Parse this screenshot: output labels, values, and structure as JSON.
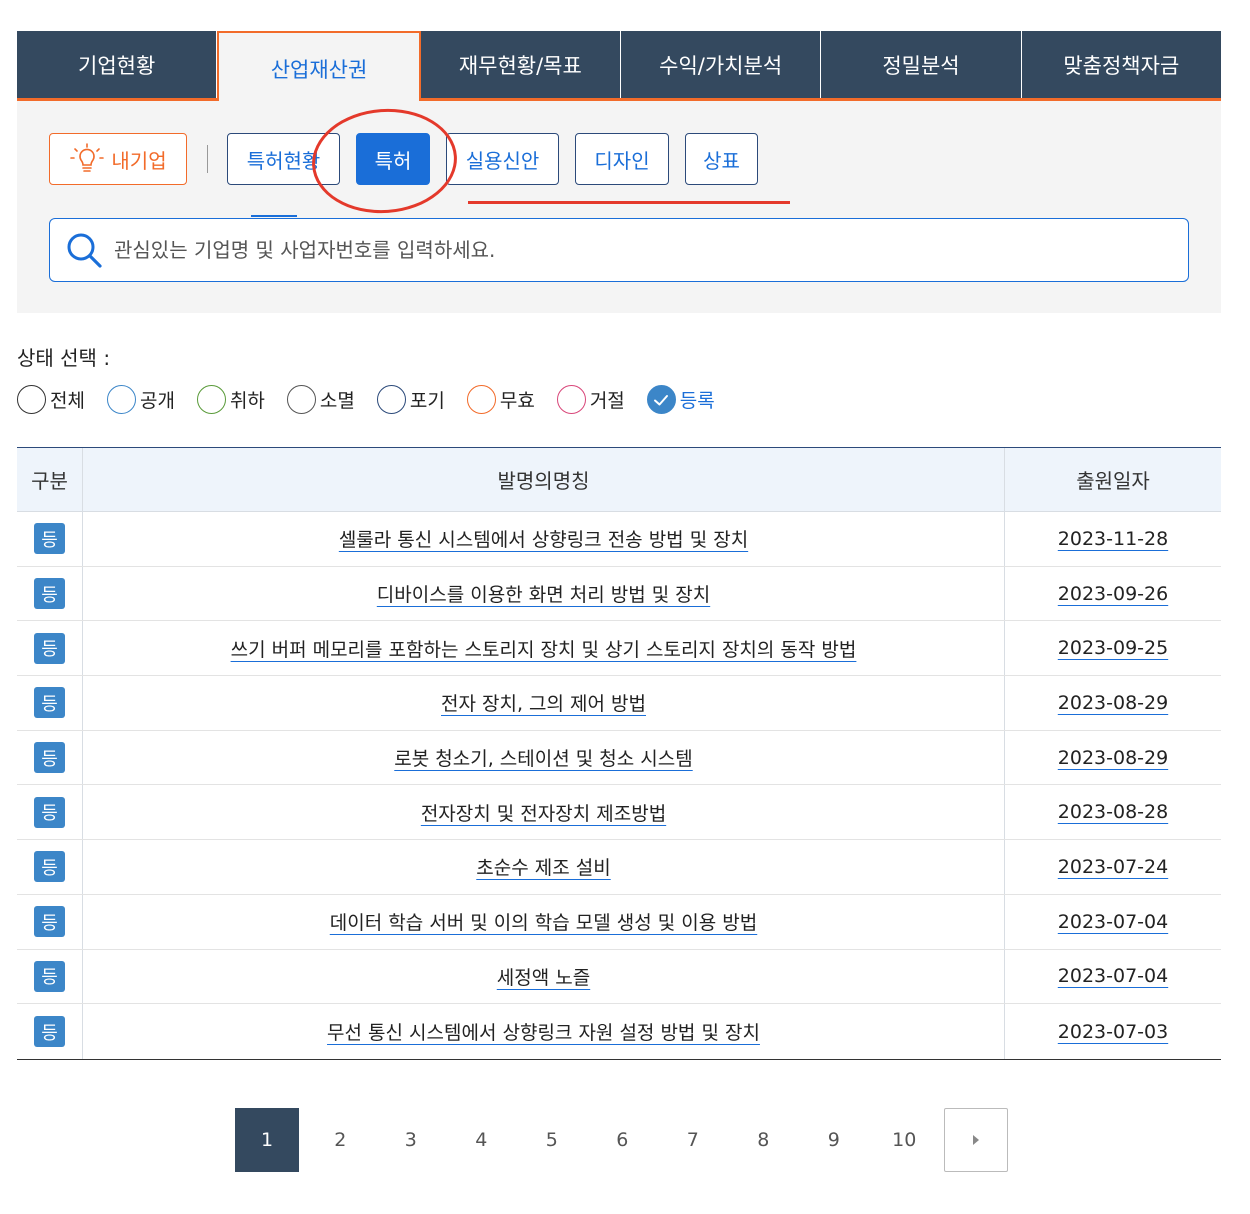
{
  "top_tabs": [
    "기업현황",
    "산업재산권",
    "재무현황/목표",
    "수익/가치분석",
    "정밀분석",
    "맞춤정책자금"
  ],
  "sub_nav": {
    "my_company": "내기업",
    "tabs": [
      "특허현황",
      "특허",
      "실용신안",
      "디자인",
      "상표"
    ]
  },
  "search": {
    "placeholder": "관심있는 기업명 및 사업자번호를 입력하세요."
  },
  "status": {
    "title": "상태 선택 :",
    "options": [
      {
        "label": "전체",
        "color": "#333333"
      },
      {
        "label": "공개",
        "color": "#3c86c8"
      },
      {
        "label": "취하",
        "color": "#5a9b3a"
      },
      {
        "label": "소멸",
        "color": "#555555"
      },
      {
        "label": "포기",
        "color": "#2c4a7a"
      },
      {
        "label": "무효",
        "color": "#f26b2a"
      },
      {
        "label": "거절",
        "color": "#d9477a"
      },
      {
        "label": "등록",
        "color": "#3c86c8"
      }
    ]
  },
  "table": {
    "headers": [
      "구분",
      "발명의명칭",
      "출원일자"
    ],
    "rows": [
      {
        "badge": "등",
        "title": "셀룰라 통신 시스템에서 상향링크 전송 방법 및 장치",
        "date": "2023-11-28"
      },
      {
        "badge": "등",
        "title": "디바이스를 이용한 화면 처리 방법 및 장치",
        "date": "2023-09-26"
      },
      {
        "badge": "등",
        "title": "쓰기 버퍼 메모리를 포함하는 스토리지 장치 및 상기 스토리지 장치의 동작 방법",
        "date": "2023-09-25"
      },
      {
        "badge": "등",
        "title": "전자 장치, 그의 제어 방법",
        "date": "2023-08-29"
      },
      {
        "badge": "등",
        "title": "로봇 청소기, 스테이션 및 청소 시스템",
        "date": "2023-08-29"
      },
      {
        "badge": "등",
        "title": "전자장치 및 전자장치 제조방법",
        "date": "2023-08-28"
      },
      {
        "badge": "등",
        "title": "초순수 제조 설비",
        "date": "2023-07-24"
      },
      {
        "badge": "등",
        "title": "데이터 학습 서버 및 이의 학습 모델 생성 및 이용 방법",
        "date": "2023-07-04"
      },
      {
        "badge": "등",
        "title": "세정액 노즐",
        "date": "2023-07-04"
      },
      {
        "badge": "등",
        "title": "무선 통신 시스템에서 상향링크 자원 설정 방법 및 장치",
        "date": "2023-07-03"
      }
    ]
  },
  "pagination": {
    "pages": [
      "1",
      "2",
      "3",
      "4",
      "5",
      "6",
      "7",
      "8",
      "9",
      "10"
    ],
    "current": "1"
  },
  "colors": {
    "nav_bg": "#34495f",
    "accent_orange": "#f26b2a",
    "accent_blue": "#1a6ed8",
    "badge_blue": "#3c86c8",
    "annotation_red": "#e4392b"
  }
}
